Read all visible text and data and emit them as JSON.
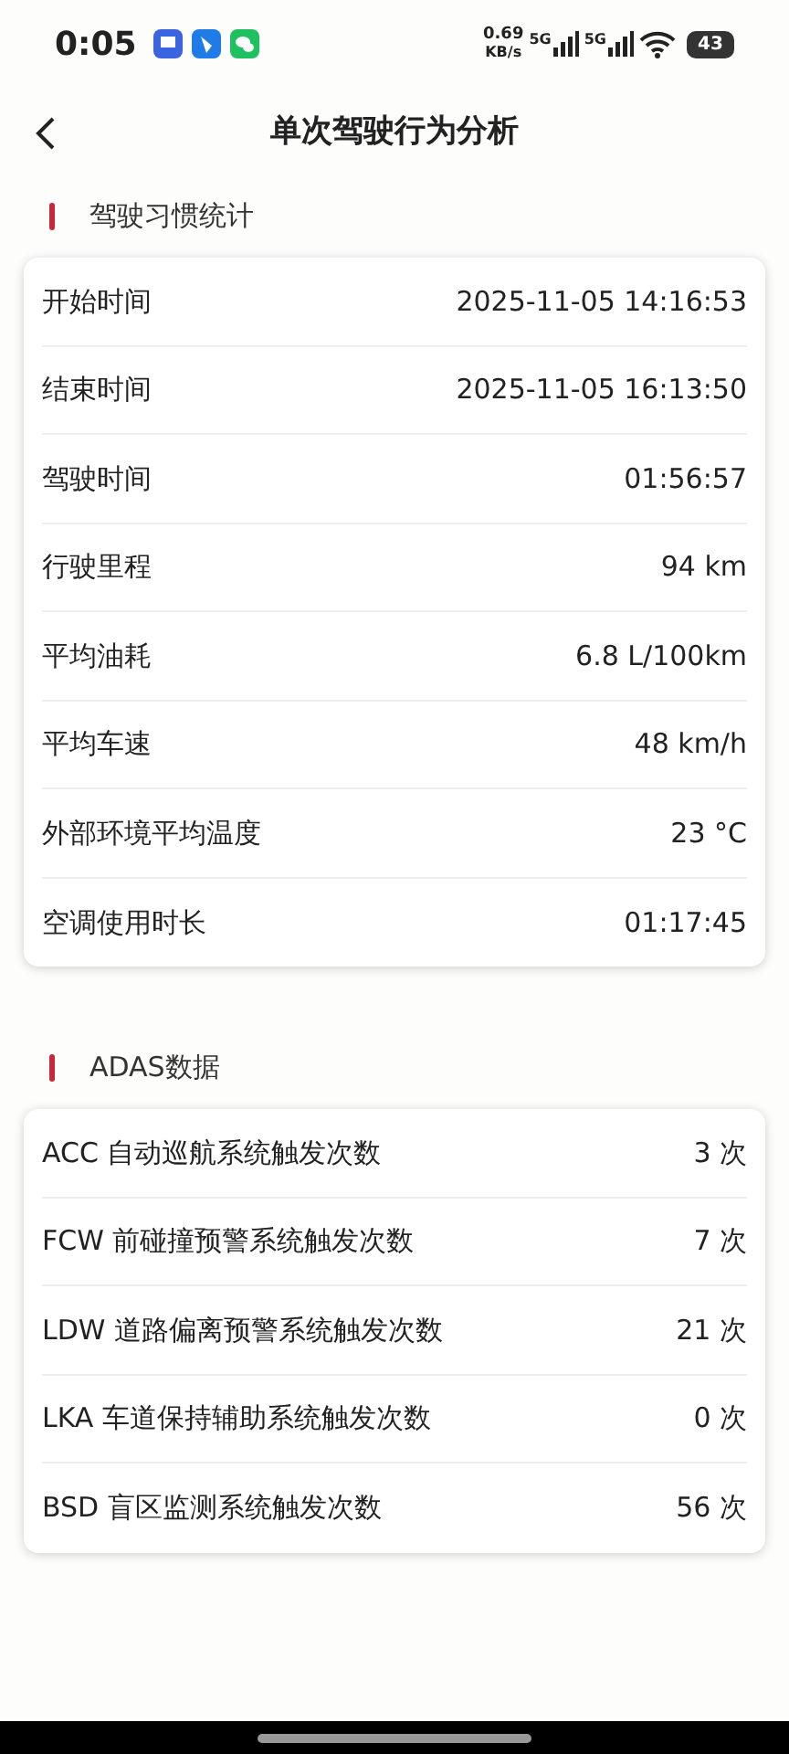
{
  "status_bar": {
    "time": "0:05",
    "speed": "0.69",
    "speed_unit": "KB/s",
    "networks": [
      "5G",
      "5G"
    ],
    "battery": "43"
  },
  "header": {
    "title": "单次驾驶行为分析"
  },
  "sections": [
    {
      "title": "驾驶习惯统计",
      "rows": [
        {
          "label": "开始时间",
          "value": "2025-11-05 14:16:53"
        },
        {
          "label": "结束时间",
          "value": "2025-11-05 16:13:50"
        },
        {
          "label": "驾驶时间",
          "value": "01:56:57"
        },
        {
          "label": "行驶里程",
          "value": "94 km"
        },
        {
          "label": "平均油耗",
          "value": "6.8 L/100km"
        },
        {
          "label": "平均车速",
          "value": "48 km/h"
        },
        {
          "label": "外部环境平均温度",
          "value": "23 °C"
        },
        {
          "label": "空调使用时长",
          "value": "01:17:45"
        }
      ]
    },
    {
      "title": "ADAS数据",
      "rows": [
        {
          "label": "ACC 自动巡航系统触发次数",
          "value": "3 次"
        },
        {
          "label": "FCW 前碰撞预警系统触发次数",
          "value": "7 次"
        },
        {
          "label": "LDW 道路偏离预警系统触发次数",
          "value": "21 次"
        },
        {
          "label": "LKA 车道保持辅助系统触发次数",
          "value": "0 次"
        },
        {
          "label": "BSD 盲区监测系统触发次数",
          "value": "56 次"
        }
      ]
    }
  ]
}
